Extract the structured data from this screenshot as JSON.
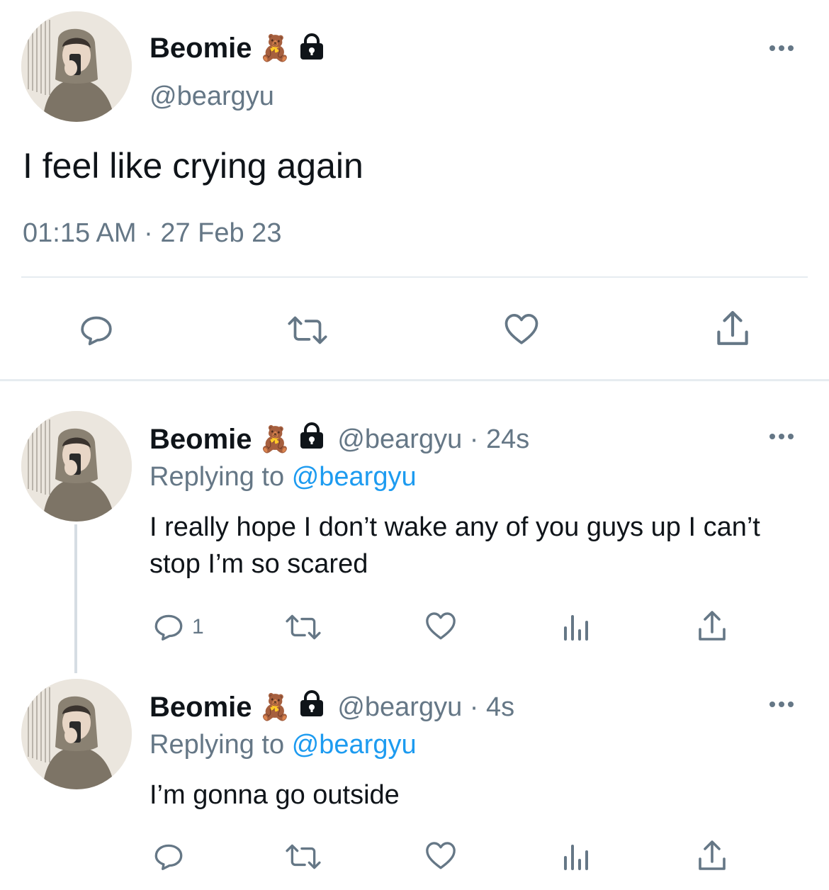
{
  "main_tweet": {
    "name": "Beomie",
    "emoji": "🧸",
    "handle": "@beargyu",
    "text": "I feel like crying again",
    "timestamp": "01:15 AM · 27 Feb 23"
  },
  "replies": [
    {
      "name": "Beomie",
      "emoji": "🧸",
      "handle_time": "@beargyu · 24s",
      "replying_prefix": "Replying to",
      "replying_handle": "@beargyu",
      "text": "I really hope I don’t wake any of you guys up I can’t stop I’m so scared",
      "reply_count": "1"
    },
    {
      "name": "Beomie",
      "emoji": "🧸",
      "handle_time": "@beargyu · 4s",
      "replying_prefix": "Replying to",
      "replying_handle": "@beargyu",
      "text": "I’m gonna go outside",
      "reply_count": ""
    }
  ],
  "colors": {
    "text": "#0f1419",
    "muted": "#657786",
    "link": "#1d9bf0",
    "divider": "#e6ecf0"
  },
  "icons": [
    "reply-icon",
    "retweet-icon",
    "like-icon",
    "share-icon",
    "analytics-icon",
    "more-icon",
    "lock-icon"
  ]
}
